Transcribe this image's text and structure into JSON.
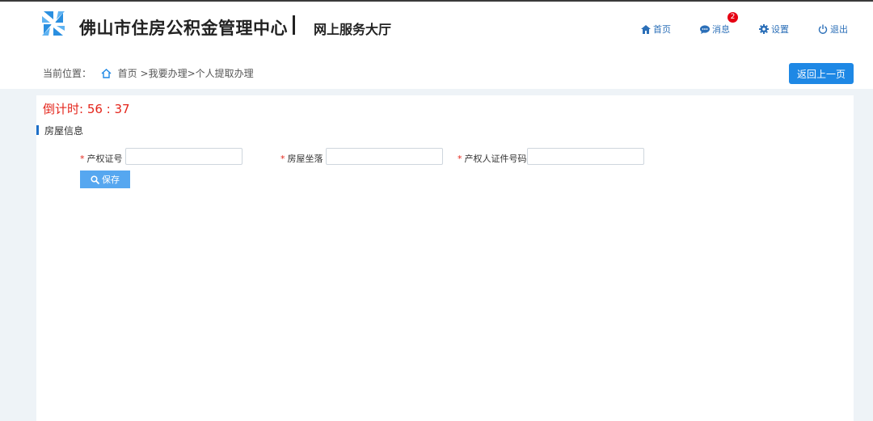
{
  "header": {
    "site_title": "佛山市住房公积金管理中心",
    "separator": "|",
    "subtitle": "网上服务大厅",
    "nav": [
      {
        "label": "首页",
        "icon": "home-icon"
      },
      {
        "label": "消息",
        "icon": "message-icon",
        "badge": "2"
      },
      {
        "label": "设置",
        "icon": "gear-icon"
      },
      {
        "label": "退出",
        "icon": "power-icon"
      }
    ]
  },
  "breadcrumb": {
    "prefix": "当前位置：",
    "home": "首页",
    "path": ">我要办理>个人提取办理"
  },
  "back_button": "返回上一页",
  "countdown": "倒计时: 56 : 37",
  "section": {
    "title": "房屋信息"
  },
  "form": {
    "fields": [
      {
        "required": "*",
        "label": "产权证号",
        "value": ""
      },
      {
        "required": "*",
        "label": "房屋坐落",
        "value": ""
      },
      {
        "required": "*",
        "label": "产权人证件号码",
        "value": ""
      }
    ],
    "save_label": "保存"
  },
  "colors": {
    "accent": "#1e88e5",
    "countdown": "#e4251b",
    "badge": "#e60012",
    "nav_text": "#2b6fb8"
  }
}
